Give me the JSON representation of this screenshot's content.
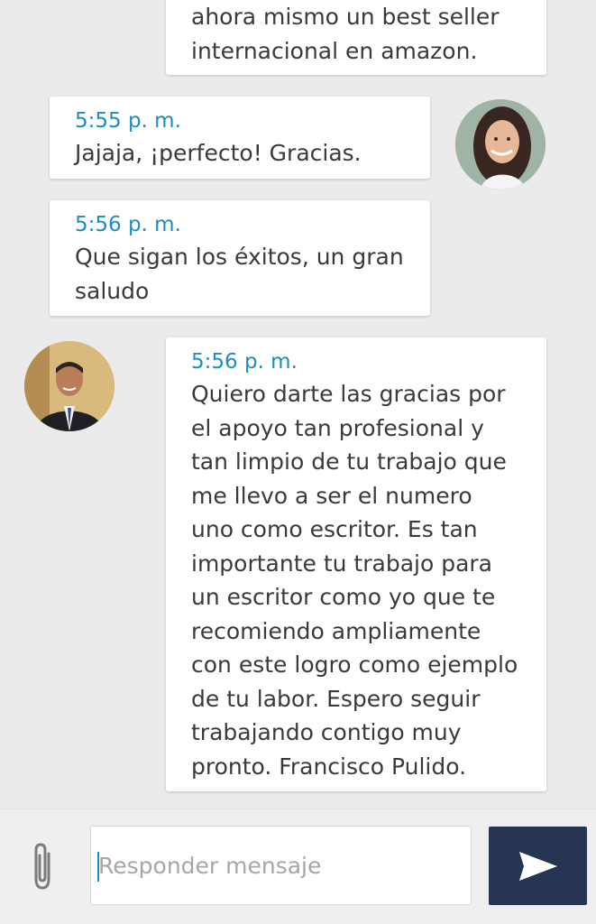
{
  "messages": [
    {
      "time": "",
      "text": "ahora mismo un best seller\ninternacional en amazon.",
      "side": "right"
    },
    {
      "time": "5:55 p. m.",
      "text": "Jajaja, ¡perfecto! Gracias.",
      "side": "left"
    },
    {
      "time": "5:56 p. m.",
      "text": "Que sigan los éxitos, un gran\nsaludo",
      "side": "left"
    },
    {
      "time": "5:56 p. m.",
      "text": "Quiero darte las gracias por\nel apoyo tan profesional y\ntan limpio de tu trabajo que\nme llevo a ser el numero\nuno como escritor. Es tan\nimportante tu trabajo para\nun escritor como yo que te\nrecomiendo ampliamente\ncon este logro como ejemplo\nde tu labor. Espero seguir\ntrabajando contigo muy\npronto. Francisco Pulido.",
      "side": "right"
    }
  ],
  "reply": {
    "placeholder": "Responder mensaje",
    "value": ""
  },
  "icons": {
    "attach": "paperclip-icon",
    "send": "send-arrow-icon"
  },
  "colors": {
    "timestamp": "#1e8bc3",
    "send_button": "#253552",
    "background": "#ebebeb"
  }
}
